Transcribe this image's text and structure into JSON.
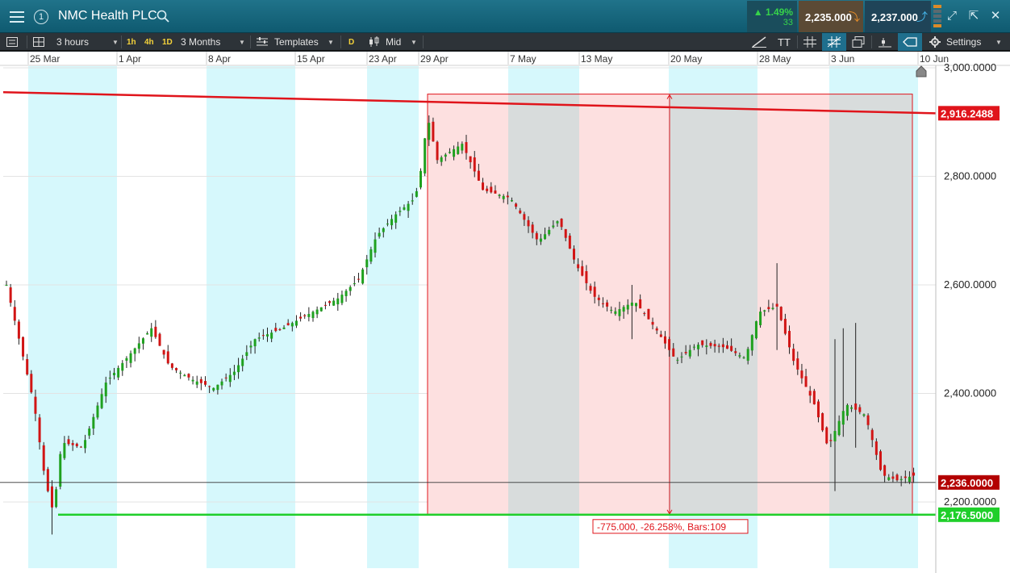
{
  "header": {
    "instrument": "NMC Health PLC",
    "workspace_number": "1",
    "change_pct": "1.49%",
    "change_pts": "33",
    "sell_price": "2,235.000",
    "buy_price": "2,237.000"
  },
  "toolbar": {
    "interval": "3 hours",
    "quick_1h": "1h",
    "quick_4h": "4h",
    "quick_1d": "1D",
    "range": "3 Months",
    "templates": "Templates",
    "draw_mode": "D",
    "price_type": "Mid",
    "text_tool": "TT",
    "settings": "Settings"
  },
  "chart_data": {
    "type": "candlestick",
    "title": "",
    "x_ticks": [
      "25 Mar",
      "1 Apr",
      "8 Apr",
      "15 Apr",
      "23 Apr",
      "29 Apr",
      "7 May",
      "13 May",
      "20 May",
      "28 May",
      "3 Jun",
      "10 Jun"
    ],
    "y_ticks": [
      "3,000.0000",
      "2,800.0000",
      "2,600.0000",
      "2,400.0000",
      "2,200.0000"
    ],
    "ylim": [
      2100,
      3020
    ],
    "current_price": "2,236.0000",
    "resistance_label": "2,916.2488",
    "support_label": "2,176.5000",
    "measure_label": "-775.000, -26.258%, Bars:109",
    "measure_range": {
      "high": 2951.5,
      "low": 2176.5,
      "bars": 109
    },
    "trendlines": [
      {
        "name": "resistance",
        "color": "#e0141b",
        "from": [
          "start",
          2955
        ],
        "to": [
          "end",
          2916.2488
        ]
      },
      {
        "name": "support",
        "color": "#1fcf2a",
        "value": 2176.5
      }
    ],
    "anchors": [
      [
        0,
        2600
      ],
      [
        20,
        2380
      ],
      [
        28,
        2240
      ],
      [
        34,
        2180
      ],
      [
        40,
        2310
      ],
      [
        55,
        2300
      ],
      [
        72,
        2420
      ],
      [
        92,
        2480
      ],
      [
        105,
        2520
      ],
      [
        118,
        2450
      ],
      [
        135,
        2425
      ],
      [
        150,
        2410
      ],
      [
        165,
        2440
      ],
      [
        180,
        2500
      ],
      [
        200,
        2520
      ],
      [
        218,
        2545
      ],
      [
        240,
        2575
      ],
      [
        255,
        2610
      ],
      [
        268,
        2690
      ],
      [
        282,
        2730
      ],
      [
        296,
        2760
      ],
      [
        300,
        2810
      ],
      [
        305,
        2910
      ],
      [
        312,
        2830
      ],
      [
        330,
        2860
      ],
      [
        345,
        2775
      ],
      [
        365,
        2760
      ],
      [
        385,
        2680
      ],
      [
        400,
        2720
      ],
      [
        412,
        2640
      ],
      [
        425,
        2580
      ],
      [
        440,
        2550
      ],
      [
        455,
        2570
      ],
      [
        470,
        2520
      ],
      [
        485,
        2460
      ],
      [
        500,
        2490
      ],
      [
        520,
        2485
      ],
      [
        535,
        2465
      ],
      [
        545,
        2550
      ],
      [
        558,
        2560
      ],
      [
        570,
        2460
      ],
      [
        585,
        2380
      ],
      [
        595,
        2300
      ],
      [
        608,
        2380
      ],
      [
        622,
        2360
      ],
      [
        634,
        2250
      ],
      [
        645,
        2240
      ],
      [
        659,
        2250
      ]
    ],
    "wicks": [
      {
        "bar": 34,
        "high": 2240,
        "low": 2140
      },
      {
        "bar": 455,
        "high": 2600,
        "low": 2500
      },
      {
        "bar": 558,
        "high": 2640,
        "low": 2480
      },
      {
        "bar": 600,
        "high": 2500,
        "low": 2220
      },
      {
        "bar": 608,
        "high": 2520,
        "low": 2320
      },
      {
        "bar": 616,
        "high": 2530,
        "low": 2300
      }
    ]
  }
}
